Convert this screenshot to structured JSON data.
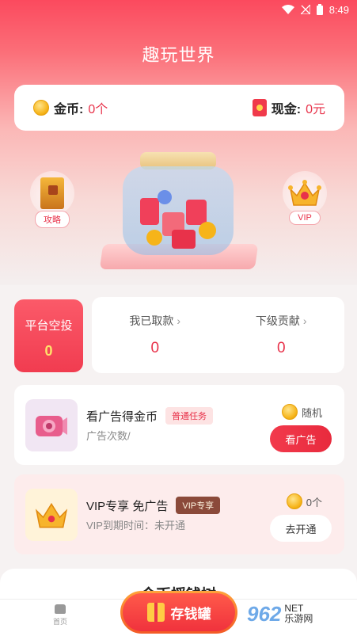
{
  "status_bar": {
    "time": "8:49"
  },
  "header": {
    "title": "趣玩世界"
  },
  "wallet": {
    "coins_label": "金币:",
    "coins_value": "0个",
    "cash_label": "现金:",
    "cash_value": "0元"
  },
  "side_buttons": {
    "guide_label": "攻略",
    "vip_label": "VIP"
  },
  "stats": {
    "airdrop_label": "平台空投",
    "airdrop_value": "0",
    "withdrawn_label": "我已取款",
    "withdrawn_value": "0",
    "subordinate_label": "下级贡献",
    "subordinate_value": "0"
  },
  "tasks": [
    {
      "title": "看广告得金币",
      "tag": "普通任务",
      "subtitle": "广告次数/",
      "reward": "随机",
      "button": "看广告"
    },
    {
      "title": "VIP专享 免广告",
      "tag": "VIP专享",
      "subtitle": "VIP到期时间：未开通",
      "reward": "0个",
      "button": "去开通"
    }
  ],
  "bottom_section": {
    "title": "金币摇钱树"
  },
  "tabbar": {
    "home_label": "首页",
    "center_button": "存钱罐"
  },
  "watermark": {
    "text": "962",
    "net": "NET",
    "site": "乐游网"
  },
  "colors": {
    "primary": "#e8324a",
    "header_gradient_top": "#fb4a5e",
    "coin": "#f6b419"
  }
}
